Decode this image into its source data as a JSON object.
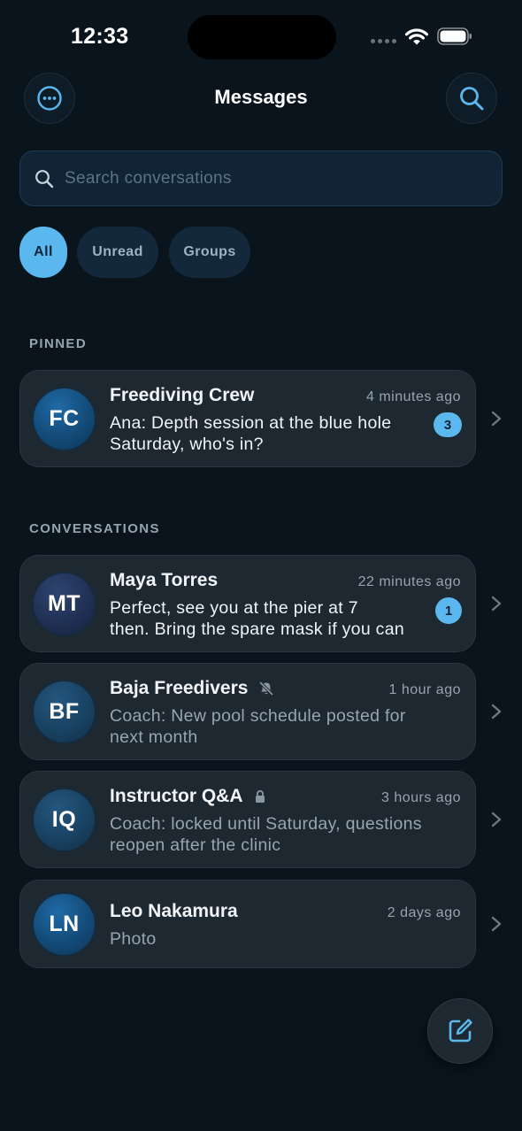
{
  "status_bar": {
    "time": "12:33"
  },
  "header": {
    "title": "Messages"
  },
  "search": {
    "placeholder": "Search conversations",
    "value": ""
  },
  "filters": [
    {
      "label": "All",
      "selected": true
    },
    {
      "label": "Unread",
      "selected": false
    },
    {
      "label": "Groups",
      "selected": false
    }
  ],
  "sections": {
    "pinned": "PINNED",
    "conversations": "CONVERSATIONS"
  },
  "pinned": [
    {
      "initials": "FC",
      "name": "Freediving Crew",
      "time": "4 minutes ago",
      "preview": "Ana: Depth session at the blue hole Saturday, who's in?",
      "unread_count": "3"
    }
  ],
  "conversations": [
    {
      "initials": "MT",
      "name": "Maya Torres",
      "time": "22 minutes ago",
      "preview": "Perfect, see you at the pier at 7 then. Bring the spare mask if you can",
      "unread_count": "1"
    },
    {
      "initials": "BF",
      "name": "Baja Freedivers",
      "time": "1 hour ago",
      "preview": "Coach: New pool schedule posted for next month",
      "status_icon": "muted-bell-icon"
    },
    {
      "initials": "IQ",
      "name": "Instructor Q&A",
      "time": "3 hours ago",
      "preview": "Coach: locked until Saturday, questions reopen after the clinic",
      "status_icon": "lock-icon"
    },
    {
      "initials": "LN",
      "name": "Leo Nakamura",
      "time": "2 days ago",
      "preview": "Photo"
    }
  ],
  "icons": {
    "more": "more-icon",
    "search": "search-icon",
    "compose": "compose-icon",
    "chevron": "chevron-right-icon"
  },
  "colors": {
    "background": "#0a141c",
    "accent": "#5ab8ef",
    "row_background": "#1e2831"
  }
}
